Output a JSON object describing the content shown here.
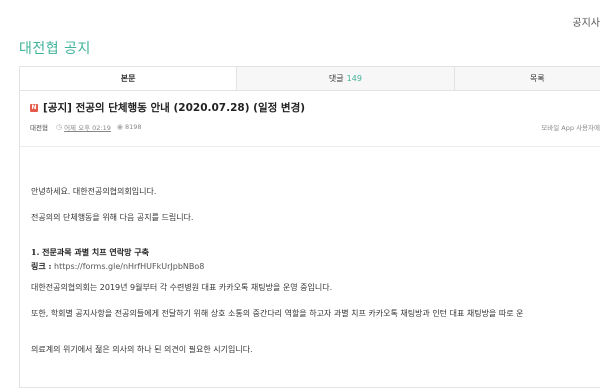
{
  "header": {
    "top_right": "공지사"
  },
  "board": {
    "title": "대전협 공지"
  },
  "tabs": [
    {
      "label": "본문"
    },
    {
      "label": "댓글",
      "count": "149"
    },
    {
      "label": "목록"
    }
  ],
  "post": {
    "badge": "N",
    "title": "[공지] 전공의 단체행동 안내 (2020.07.28) (일정 변경)",
    "author": "대전협",
    "date": "어제 오후 02:19",
    "views": "8198",
    "mobile_note": "모바일 App 사용자에게는 알"
  },
  "content": {
    "greeting": "안녕하세요. 대한전공의협의회입니다.",
    "intro": "전공의의 단체행동을 위해 다음 공지를 드립니다.",
    "section1_title": "1. 전문과목 과별 치프 연락망 구축",
    "link_label": "링크 :",
    "link_url": "https://forms.gle/nHrfHUFkUrJpbNBo8",
    "para1": "대한전공의협의회는 2019년 9월부터 각 수련병원 대표 카카오톡 채팅방을 운영 중입니다.",
    "para2": "또한, 학회별 공지사항을 전공의들에게 전달하기 위해 상호 소통의 중간다리 역할을 하고자 과별 치프 카카오톡 채팅방과 인턴 대표 채팅방을 따로 운",
    "para3": "의료계의 위기에서 젊은 의사의 하나 된 의견이 필요한 시기입니다."
  }
}
